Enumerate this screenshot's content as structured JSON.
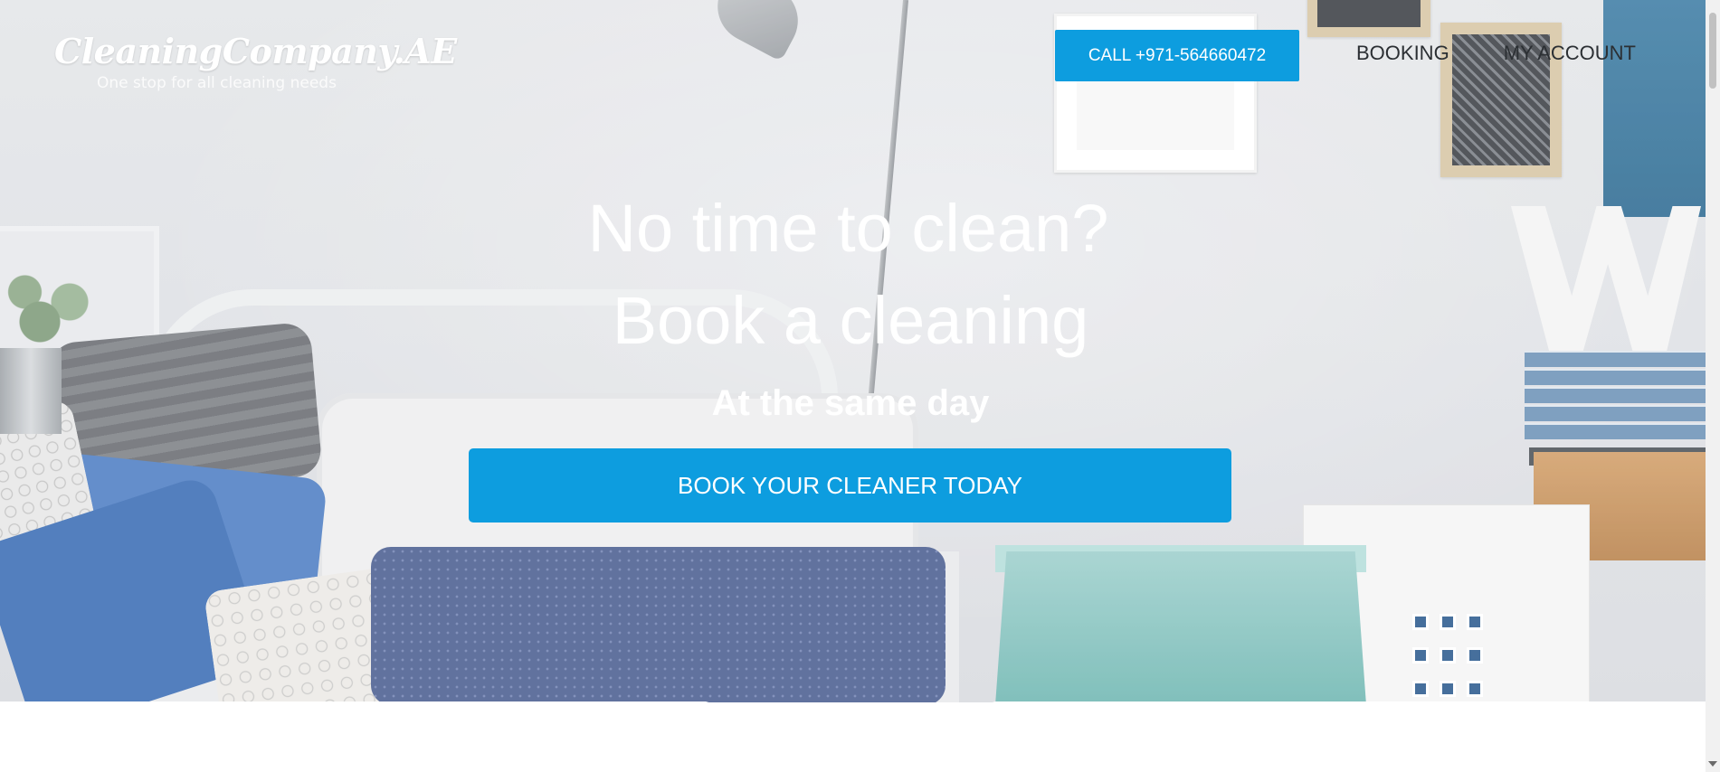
{
  "logo": {
    "title": "CleaningCompany.AE",
    "tagline": "One stop for all cleaning needs"
  },
  "header": {
    "call_label": "CALL +971-564660472",
    "nav": [
      {
        "label": "BOOKING"
      },
      {
        "label": "MY ACCOUNT"
      }
    ]
  },
  "hero": {
    "headline_line1": "No time to clean?",
    "headline_line2": "Book a cleaning",
    "subheadline": "At the same day",
    "cta_label": "BOOK YOUR CLEANER TODAY"
  },
  "colors": {
    "accent": "#0d9ddf",
    "nav_text": "#2b2f33",
    "hero_text": "#ffffff"
  }
}
